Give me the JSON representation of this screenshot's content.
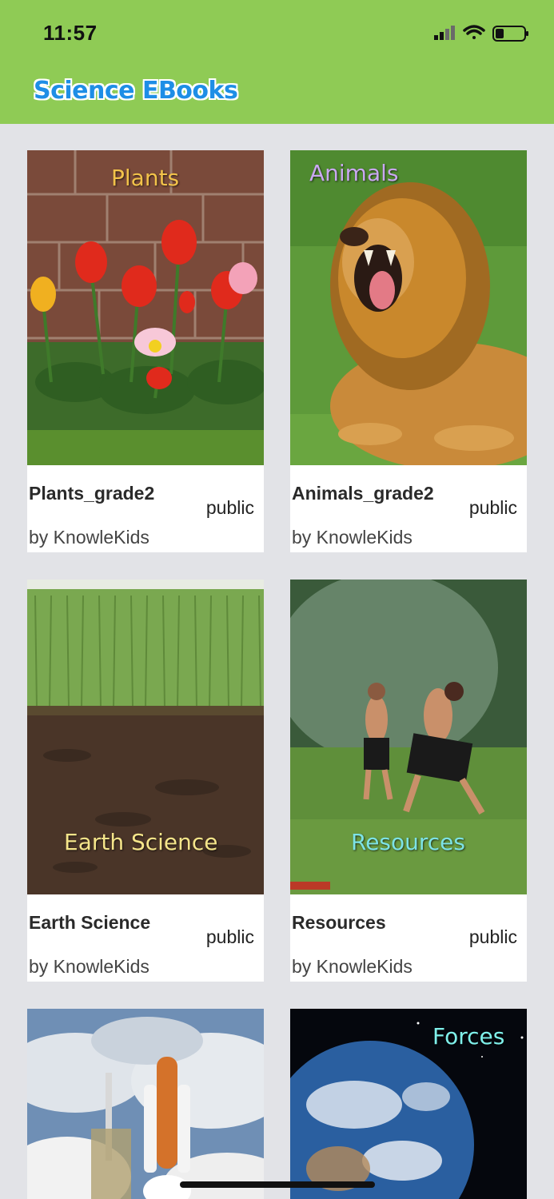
{
  "status_bar": {
    "time": "11:57"
  },
  "app": {
    "title": "Science EBooks"
  },
  "books": [
    {
      "title": "Plants_grade2",
      "visibility": "public",
      "author": "by KnowleKids",
      "cover_label": "Plants",
      "cover_label_color": "#f2c24a"
    },
    {
      "title": "Animals_grade2",
      "visibility": "public",
      "author": "by KnowleKids",
      "cover_label": "Animals",
      "cover_label_color": "#c9a8f0"
    },
    {
      "title": "Earth Science",
      "visibility": "public",
      "author": "by KnowleKids",
      "cover_label": "Earth Science",
      "cover_label_color": "#f5e58a"
    },
    {
      "title": "Resources",
      "visibility": "public",
      "author": "by KnowleKids",
      "cover_label": "Resources",
      "cover_label_color": "#7de3e6"
    },
    {
      "title": "",
      "visibility": "",
      "author": "",
      "cover_label": "",
      "cover_label_color": ""
    },
    {
      "title": "",
      "visibility": "",
      "author": "",
      "cover_label": "Forces",
      "cover_label_color": "#7ff0ea"
    }
  ]
}
